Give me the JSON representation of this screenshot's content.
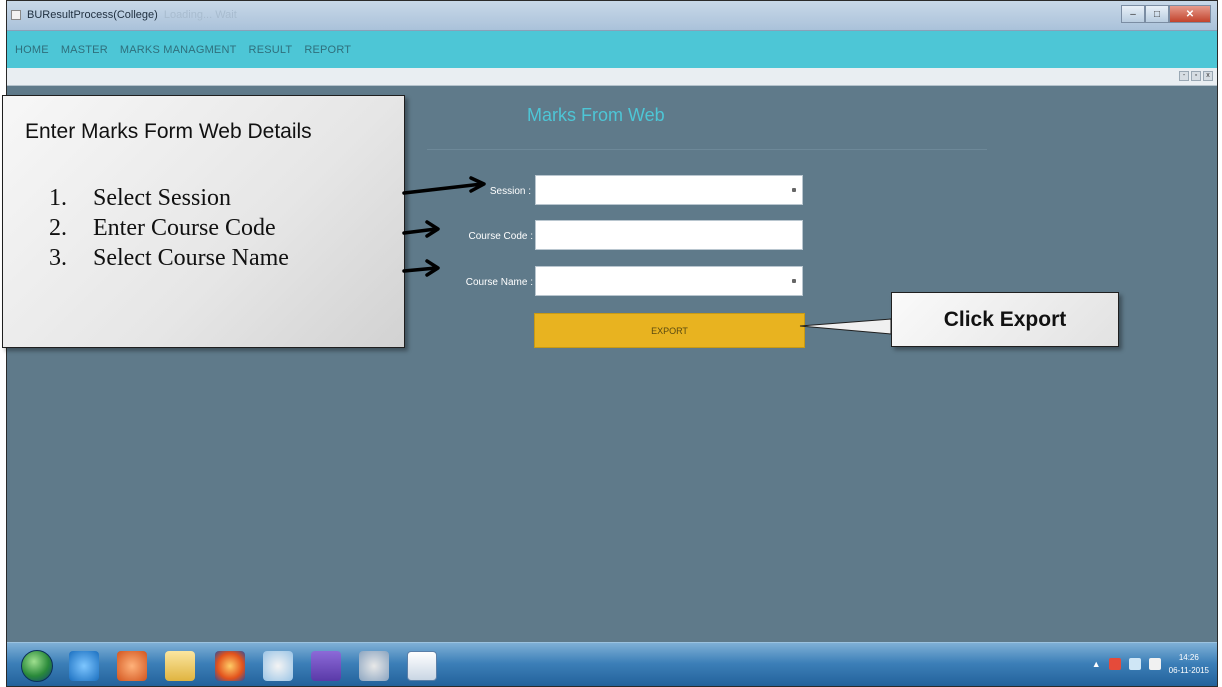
{
  "window": {
    "title": "BUResultProcess(College)",
    "title_faded": "Loading... Wait",
    "minimize_icon": "minimize-icon",
    "maximize_icon": "maximize-icon",
    "close_icon": "close-icon"
  },
  "menu": {
    "items": [
      {
        "label": "HOME"
      },
      {
        "label": "MASTER"
      },
      {
        "label": "MARKS MANAGMENT"
      },
      {
        "label": "RESULT"
      },
      {
        "label": "REPORT"
      }
    ]
  },
  "form": {
    "title": "Marks From Web",
    "session_label": "Session :",
    "session_value": "",
    "course_code_label": "Course Code :",
    "course_code_value": "",
    "course_name_label": "Course Name :",
    "course_name_value": "",
    "export_label": "EXPORT"
  },
  "callouts": {
    "left_heading": "Enter Marks Form Web Details",
    "steps": [
      {
        "num": "1.",
        "text": "Select Session"
      },
      {
        "num": "2.",
        "text": "Enter Course Code"
      },
      {
        "num": "3.",
        "text": "Select Course Name"
      }
    ],
    "right_text": "Click Export"
  },
  "taskbar": {
    "time": "14:26",
    "date": "06-11-2015",
    "icons": [
      "ie-icon",
      "media-player-icon",
      "folder-icon",
      "firefox-icon",
      "paint-icon",
      "visual-studio-icon",
      "tool-icon",
      "notepad-icon"
    ]
  },
  "colors": {
    "menubar": "#4dc6d6",
    "form_background": "#5f7a8a",
    "export_button": "#e8b320"
  }
}
